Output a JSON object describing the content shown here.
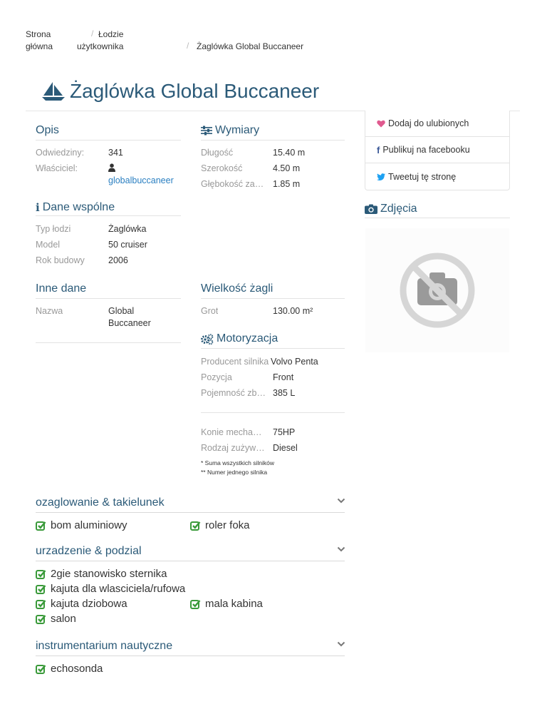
{
  "breadcrumb": {
    "home_line1": "Strona",
    "home_line2": "główna",
    "user_boats_line1": "Łodzie",
    "user_boats_line2": "użytkownika",
    "current": "Żaglówka Global Buccaneer",
    "separator": "/"
  },
  "page": {
    "title": "Żaglówka Global Buccaneer",
    "title_icon": "sailboat-icon"
  },
  "opis": {
    "heading": "Opis",
    "visits_label": "Odwiedziny:",
    "visits_value": "341",
    "owner_label": "Właściciel:",
    "owner_icon": "user-icon",
    "owner_value": "globalbuccaneer"
  },
  "wymiary": {
    "heading": "Wymiary",
    "icon": "sliders-icon",
    "length_label": "Długość",
    "length_value": "15.40 m",
    "width_label": "Szerokość",
    "width_value": "4.50 m",
    "depth_label": "Głębokość zanurzenia",
    "depth_value": "1.85 m"
  },
  "dane_wspolne": {
    "heading": "Dane wspólne",
    "icon": "info-icon",
    "type_label": "Typ łodzi",
    "type_value": "Żaglówka",
    "model_label": "Model",
    "model_value": "50 cruiser",
    "year_label": "Rok budowy",
    "year_value": "2006"
  },
  "inne_dane": {
    "heading": "Inne dane",
    "name_label": "Nazwa",
    "name_value_line1": "Global",
    "name_value_line2": "Buccaneer"
  },
  "zagle": {
    "heading": "Wielkość żagli",
    "grot_label": "Grot",
    "grot_value": "130.00 m²"
  },
  "motoryzacja": {
    "heading": "Motoryzacja",
    "icon": "cogs-icon",
    "producer_label": "Producent silnika",
    "producer_value": "Volvo Penta",
    "position_label": "Pozycja",
    "position_value": "Front",
    "tank_label": "Pojemność zbiornika",
    "tank_value": "385 L",
    "hp_label": "Konie mechaniczne",
    "hp_value": "75HP",
    "fuel_label": "Rodzaj zużywanego paliwa",
    "fuel_value": "Diesel",
    "note1": "* Suma wszystkich silników",
    "note2": "** Numer jednego silnika"
  },
  "side": {
    "favorite": "Dodaj do ulubionych",
    "favorite_icon": "heart-icon",
    "facebook": "Publikuj na facebooku",
    "facebook_icon": "facebook-icon",
    "tweet": "Tweetuj tę stronę",
    "tweet_icon": "twitter-icon",
    "photos_heading": "Zdjęcia",
    "photos_icon": "camera-icon",
    "no_photo_icon": "no-photo-icon"
  },
  "features": [
    {
      "heading": "ozaglowanie & takielunek",
      "items": [
        "bom aluminiowy",
        "roler foka"
      ]
    },
    {
      "heading": "urzadzenie & podzial",
      "items": [
        "2gie stanowisko sternika",
        "kajuta dla wlasciciela/rufowa",
        "kajuta dziobowa",
        "mala kabina",
        "salon"
      ]
    },
    {
      "heading": "instrumentarium nautyczne",
      "items": [
        "echosonda"
      ]
    }
  ],
  "colors": {
    "heading": "#2b5a78",
    "link": "#2a7fc1",
    "check": "#3a9a3a",
    "heart": "#e05a8f",
    "twitter": "#1da1f2",
    "facebook": "#3b5998"
  }
}
